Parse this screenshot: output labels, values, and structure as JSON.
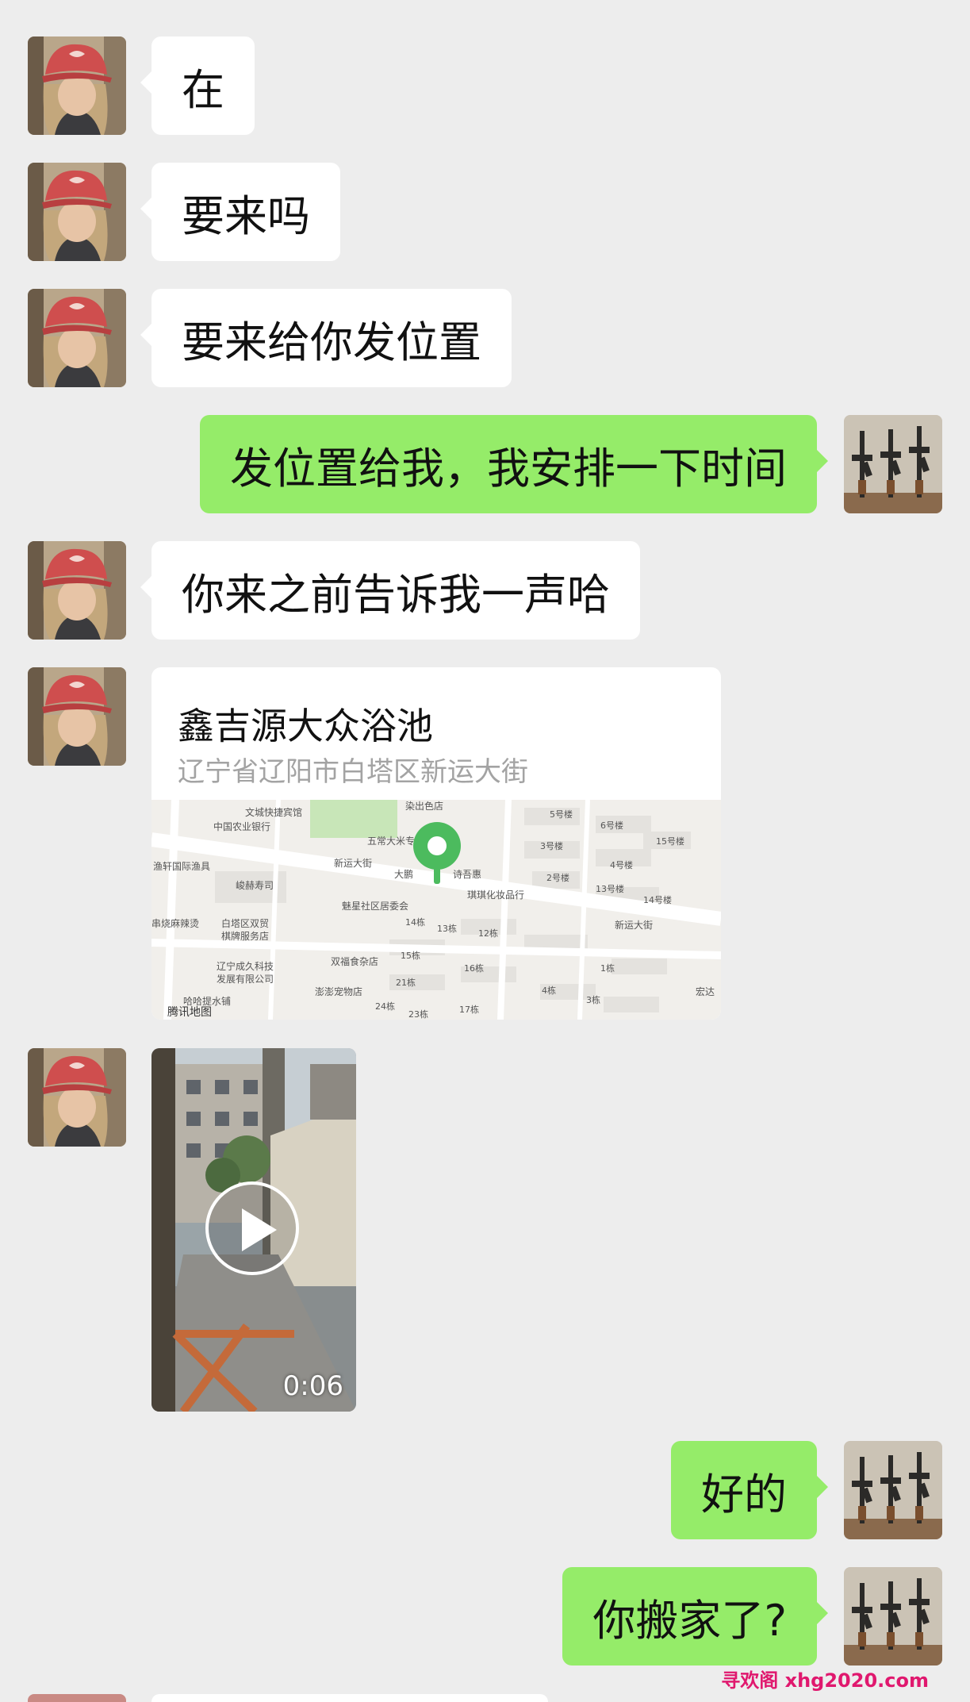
{
  "messages": {
    "m1": "在",
    "m2": "要来吗",
    "m3": "要来给你发位置",
    "m4": "发位置给我，我安排一下时间",
    "m5": "你来之前告诉我一声哈",
    "m6": "好的",
    "m7": "你搬家了?"
  },
  "location": {
    "title": "鑫吉源大众浴池",
    "address": "辽宁省辽阳市白塔区新运大街",
    "map_brand": "腾讯地图",
    "map_labels": {
      "l1": "文城快捷宾馆",
      "l2": "染出色店",
      "l3": "中国农业银行",
      "l4": "五常大米专",
      "l5": "新运大街",
      "l6": "渔轩国际渔具",
      "l7": "峻赫寿司",
      "l8": "大鹏",
      "l9": "诗吾惠",
      "l10": "琪琪化妆品行",
      "l11": "魅星社区居委会",
      "l12": "串烧麻辣烫",
      "l13": "白塔区双贸",
      "l14": "棋牌服务店",
      "l15": "辽宁成久科技",
      "l16": "发展有限公司",
      "l17": "双福食杂店",
      "l18": "澎澎宠物店",
      "l19": "哈哈提水铺",
      "l20": "新运大街",
      "l21": "宏达",
      "b1": "5号楼",
      "b2": "6号楼",
      "b3": "3号楼",
      "b4": "15号楼",
      "b5": "4号楼",
      "b6": "2号楼",
      "b7": "13号楼",
      "b8": "14号楼",
      "b9": "14栋",
      "b10": "13栋",
      "b11": "12栋",
      "b12": "15栋",
      "b13": "16栋",
      "b14": "21栋",
      "b15": "4栋",
      "b16": "1栋",
      "b17": "3栋",
      "b18": "24栋",
      "b19": "23栋",
      "b20": "17栋"
    }
  },
  "video": {
    "duration": "0:06"
  },
  "watermark": "寻欢阁 xhg2020.com",
  "colors": {
    "background": "#ededed",
    "incoming_bubble": "#ffffff",
    "outgoing_bubble": "#95ec69",
    "map_pin": "#4cbb5e",
    "watermark": "#e0186e"
  },
  "icons": {
    "contact_avatar": "woman-red-cap-avatar",
    "self_avatar": "rifles-avatar",
    "play": "play-icon",
    "map_pin": "map-pin-icon"
  }
}
